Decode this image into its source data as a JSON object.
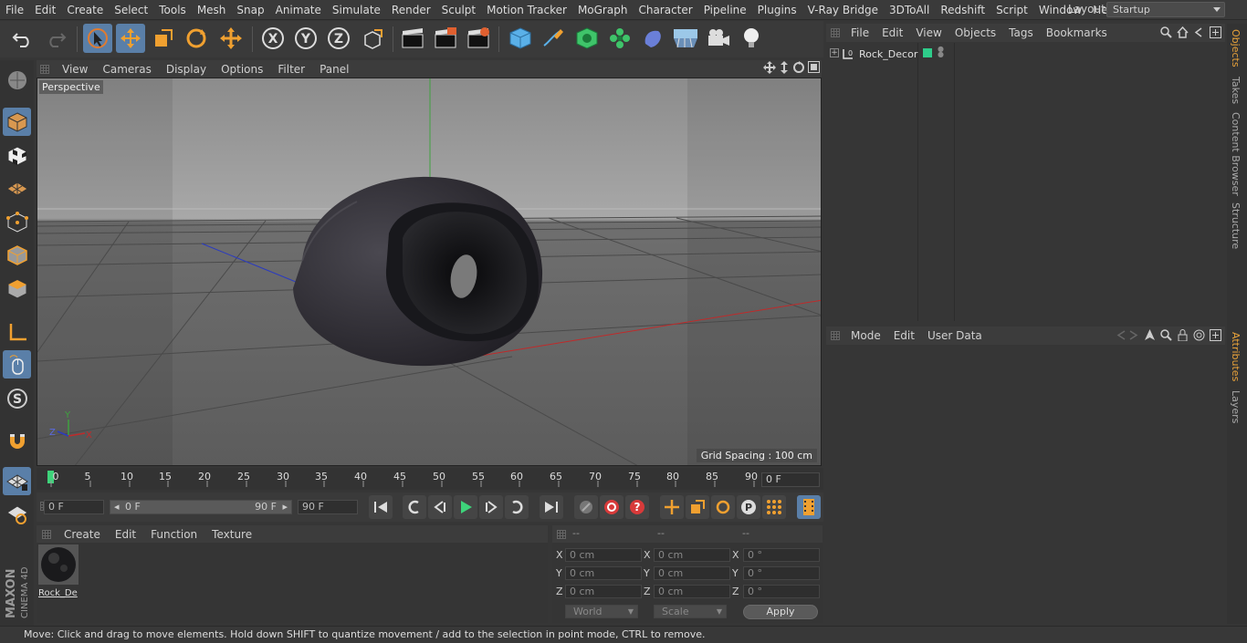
{
  "menubar": {
    "items": [
      "File",
      "Edit",
      "Create",
      "Select",
      "Tools",
      "Mesh",
      "Snap",
      "Animate",
      "Simulate",
      "Render",
      "Sculpt",
      "Motion Tracker",
      "MoGraph",
      "Character",
      "Pipeline",
      "Plugins",
      "V-Ray Bridge",
      "3DToAll",
      "Redshift",
      "Script",
      "Window",
      "Help"
    ],
    "layout_label": "Layout:",
    "layout_value": "Startup"
  },
  "viewport": {
    "menu": [
      "View",
      "Cameras",
      "Display",
      "Options",
      "Filter",
      "Panel"
    ],
    "camera_label": "Perspective",
    "grid_spacing": "Grid Spacing : 100 cm",
    "axis_x": "X",
    "axis_y": "Y",
    "axis_z": "Z"
  },
  "timeline": {
    "ticks": [
      "0",
      "5",
      "10",
      "15",
      "20",
      "25",
      "30",
      "35",
      "40",
      "45",
      "50",
      "55",
      "60",
      "65",
      "70",
      "75",
      "80",
      "85",
      "90"
    ],
    "current_frame": "0 F"
  },
  "transport": {
    "start_field": "0 F",
    "range_start": "0 F",
    "range_end": "90 F",
    "end_field": "90 F"
  },
  "material_manager": {
    "menu": [
      "Create",
      "Edit",
      "Function",
      "Texture"
    ],
    "material_name": "Rock_De"
  },
  "coordinates": {
    "headers": [
      "--",
      "--",
      "--"
    ],
    "rows": [
      {
        "axis": "X",
        "pos": "0 cm",
        "size": "0 cm",
        "rot": "0 °"
      },
      {
        "axis": "Y",
        "pos": "0 cm",
        "size": "0 cm",
        "rot": "0 °"
      },
      {
        "axis": "Z",
        "pos": "0 cm",
        "size": "0 cm",
        "rot": "0 °"
      }
    ],
    "rot_labels": [
      "X",
      "Y",
      "Z"
    ],
    "mode_world": "World",
    "mode_scale": "Scale",
    "apply": "Apply"
  },
  "object_manager": {
    "menu": [
      "File",
      "Edit",
      "View",
      "Objects",
      "Tags",
      "Bookmarks"
    ],
    "object_name": "Rock_Decor",
    "object_color": "#2ecc8a"
  },
  "attribute_manager": {
    "menu": [
      "Mode",
      "Edit",
      "User Data"
    ]
  },
  "right_tabs": [
    "Objects",
    "Takes",
    "Content Browser",
    "Structure",
    "Attributes",
    "Layers"
  ],
  "status": "Move: Click and drag to move elements. Hold down SHIFT to quantize movement / add to the selection in point mode, CTRL to remove.",
  "brand": {
    "line1": "MAXON",
    "line2": "CINEMA 4D"
  },
  "colors": {
    "accent": "#5a7fa8",
    "orange": "#e8a23a",
    "timeline_marker": "#3ed37a"
  }
}
